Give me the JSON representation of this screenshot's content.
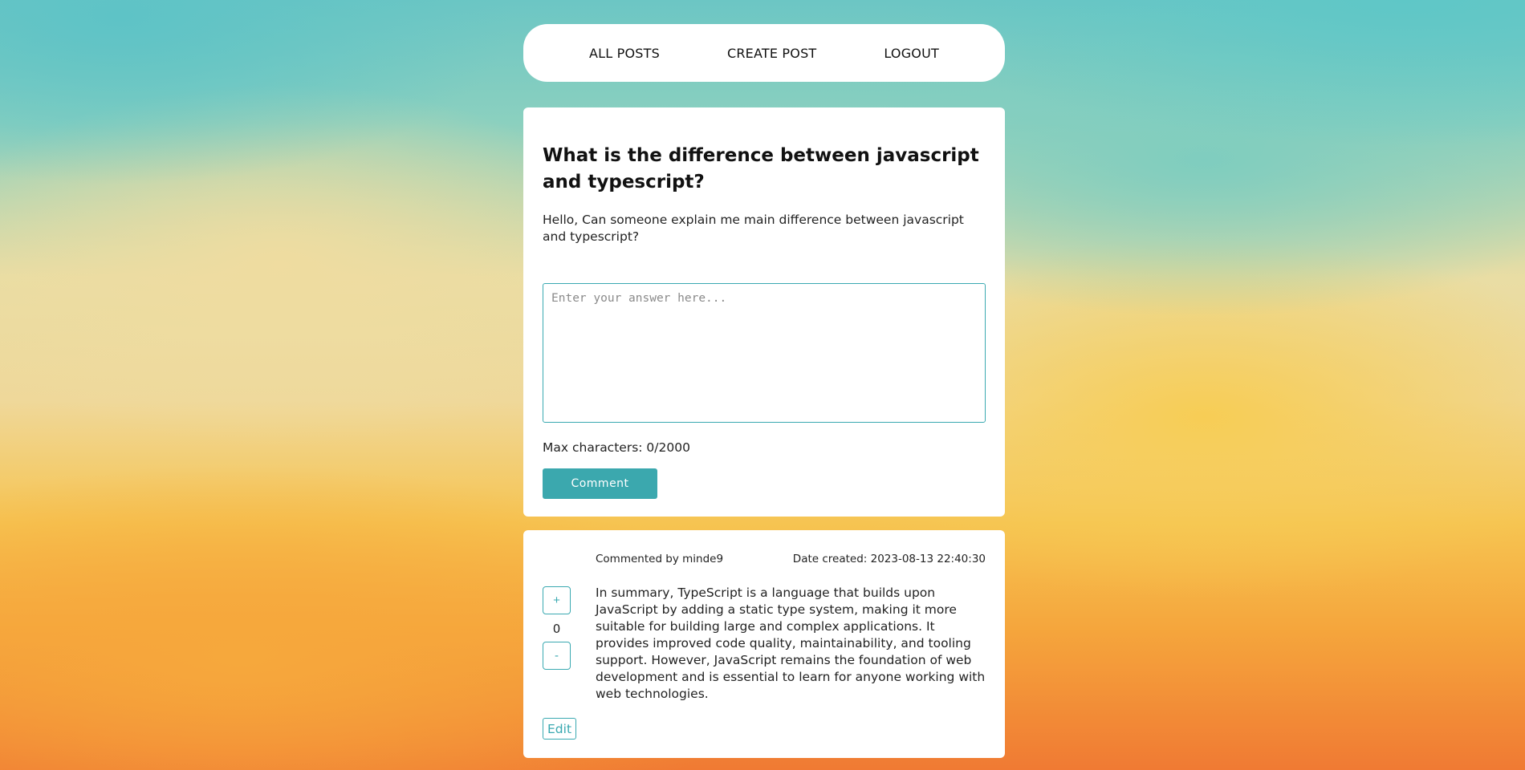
{
  "nav": {
    "all_posts": "ALL POSTS",
    "create_post": "CREATE POST",
    "logout": "LOGOUT"
  },
  "post": {
    "title": "What is the difference between javascript and typescript?",
    "body": "Hello, Can someone explain me main difference between javascript and typescript?",
    "answer_placeholder": "Enter your answer here...",
    "answer_value": "",
    "max_chars_label": "Max characters: 0/2000",
    "comment_button": "Comment"
  },
  "comments": [
    {
      "author_label": "Commented by minde9",
      "date_label": "Date created: 2023-08-13 22:40:30",
      "upvote_label": "+",
      "vote_count": "0",
      "downvote_label": "-",
      "text": "In summary, TypeScript is a language that builds upon JavaScript by adding a static type system, making it more suitable for building large and complex applications. It provides improved code quality, maintainability, and tooling support. However, JavaScript remains the foundation of web development and is essential to learn for anyone working with web technologies.",
      "edit_label": "Edit"
    }
  ],
  "colors": {
    "accent": "#3ba8ae",
    "card_background": "#ffffff",
    "text": "#222222"
  }
}
